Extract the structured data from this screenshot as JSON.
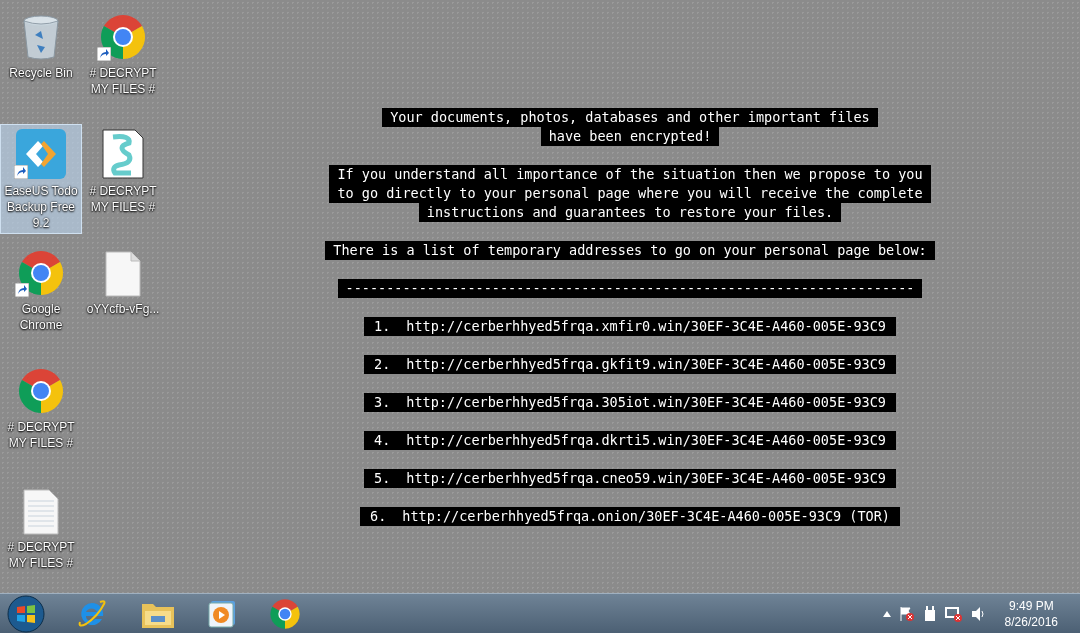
{
  "desktop_icons": [
    {
      "kind": "recycle-bin",
      "label": "Recycle Bin",
      "shortcut": false,
      "selected": false
    },
    {
      "kind": "chrome",
      "label": "# DECRYPT MY FILES #",
      "shortcut": true,
      "selected": false
    },
    {
      "kind": "backup-app",
      "label": "EaseUS Todo Backup Free 9.2",
      "shortcut": true,
      "selected": true
    },
    {
      "kind": "script",
      "label": "# DECRYPT MY FILES #",
      "shortcut": false,
      "selected": false
    },
    {
      "kind": "chrome",
      "label": "Google Chrome",
      "shortcut": true,
      "selected": false
    },
    {
      "kind": "file",
      "label": "oYYcfb-vFg...",
      "shortcut": false,
      "selected": false
    },
    {
      "kind": "chrome",
      "label": "# DECRYPT MY FILES #",
      "shortcut": false,
      "selected": false
    },
    {
      "kind": "text-file",
      "label": "# DECRYPT MY FILES #",
      "shortcut": false,
      "selected": false
    }
  ],
  "note": {
    "paragraphs": [
      [
        "Your documents, photos, databases and other important files",
        "have been encrypted!"
      ],
      [
        "If you understand all importance of the situation then we propose to you",
        "to go directly to your personal page where you will receive the complete",
        "instructions and guarantees to restore your files."
      ],
      [
        "There is a list of temporary addresses to go on your personal page below:"
      ]
    ],
    "separator": "----------------------------------------------------------------------",
    "addresses": [
      {
        "number": "1.",
        "url": "http://cerberhhyed5frqa.xmfir0.win/30EF-3C4E-A460-005E-93C9"
      },
      {
        "number": "2.",
        "url": "http://cerberhhyed5frqa.gkfit9.win/30EF-3C4E-A460-005E-93C9"
      },
      {
        "number": "3.",
        "url": "http://cerberhhyed5frqa.305iot.win/30EF-3C4E-A460-005E-93C9"
      },
      {
        "number": "4.",
        "url": "http://cerberhhyed5frqa.dkrti5.win/30EF-3C4E-A460-005E-93C9"
      },
      {
        "number": "5.",
        "url": "http://cerberhhyed5frqa.cneo59.win/30EF-3C4E-A460-005E-93C9"
      },
      {
        "number": "6.",
        "url": "http://cerberhhyed5frqa.onion/30EF-3C4E-A460-005E-93C9 (TOR)"
      }
    ]
  },
  "taskbar": {
    "pinned": [
      {
        "kind": "browser-e"
      },
      {
        "kind": "folder"
      },
      {
        "kind": "media-player"
      },
      {
        "kind": "chrome"
      }
    ],
    "tray": {
      "time": "9:49 PM",
      "date": "8/26/2016"
    }
  }
}
